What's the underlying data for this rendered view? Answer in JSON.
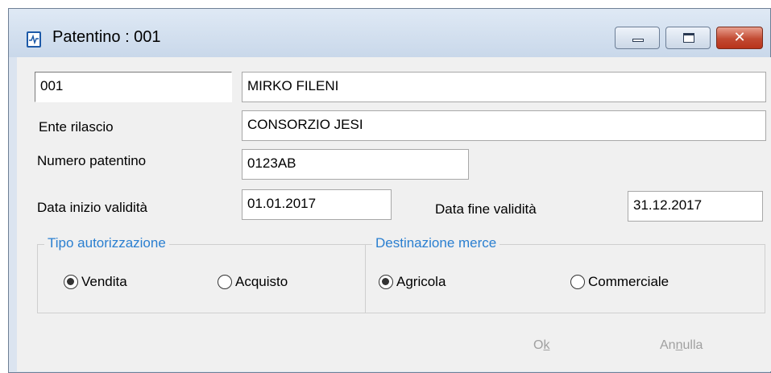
{
  "window": {
    "title": "Patentino : 001",
    "min_label": "▁",
    "max_label": "□",
    "close_label": "✕"
  },
  "form": {
    "code": "001",
    "name": "MIRKO FILENI",
    "ente_label": "Ente rilascio",
    "ente_value": "CONSORZIO JESI",
    "numero_label": "Numero patentino",
    "numero_value": "0123AB",
    "inizio_label": "Data inizio validità",
    "inizio_value": "01.01.2017",
    "fine_label": "Data fine validità",
    "fine_value": "31.12.2017"
  },
  "tipo": {
    "legend": "Tipo autorizzazione",
    "options": [
      {
        "label": "Vendita",
        "selected": true
      },
      {
        "label": "Acquisto",
        "selected": false
      }
    ]
  },
  "destinazione": {
    "legend": "Destinazione merce",
    "options": [
      {
        "label": "Agricola",
        "selected": true
      },
      {
        "label": "Commerciale",
        "selected": false
      }
    ]
  },
  "buttons": {
    "ok_pre": "O",
    "ok_accel": "k",
    "annulla_pre": "An",
    "annulla_accel": "n",
    "annulla_post": "ulla"
  },
  "colors": {
    "legend": "#2a7fd0",
    "disabled_text": "#a0a0a0",
    "close_button": "#c24a32"
  }
}
